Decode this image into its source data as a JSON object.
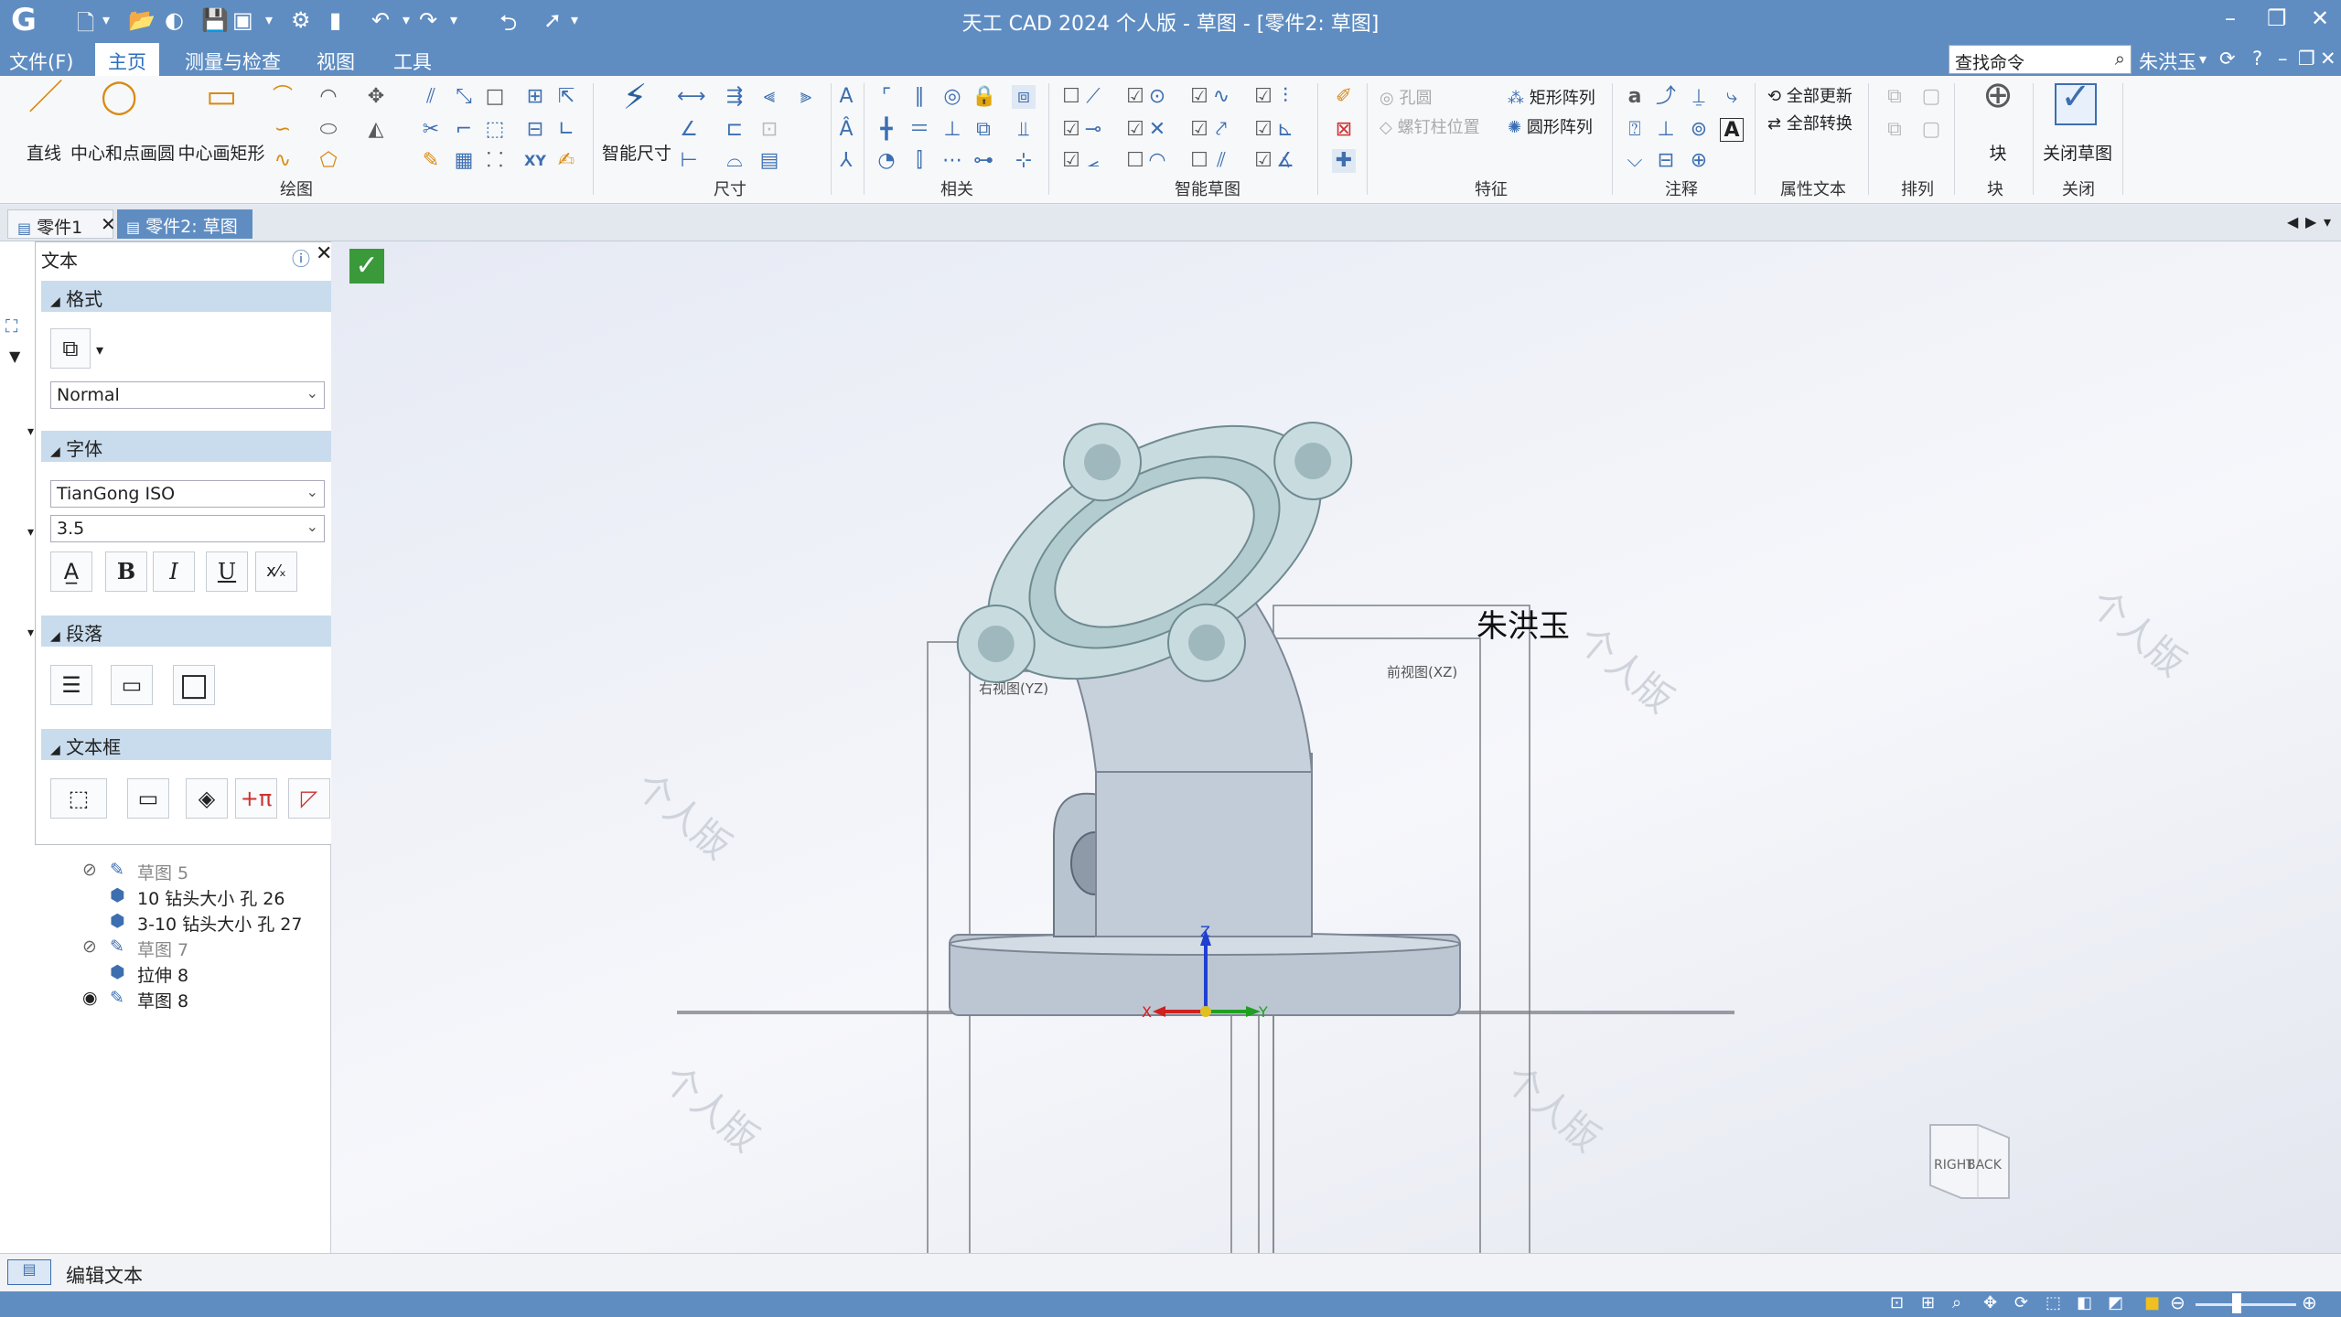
{
  "app": {
    "title": "天工 CAD 2024 个人版 - 草图 - [零件2: 草图]"
  },
  "menu": {
    "file": "文件(F)",
    "home": "主页",
    "measure": "测量与检查",
    "view": "视图",
    "tools": "工具",
    "search_placeholder": "查找命令",
    "user": "朱洪玉"
  },
  "ribbon": {
    "draw": {
      "group": "绘图",
      "line": "直线",
      "circle": "中心和点画圆",
      "rect": "中心画矩形"
    },
    "dimension": {
      "group": "尺寸",
      "smart": "智能尺寸"
    },
    "relations": {
      "group": "相关"
    },
    "smart_sketch": {
      "group": "智能草图"
    },
    "features": {
      "group": "特征",
      "hole": "孔圆",
      "bolt": "螺钉柱位置",
      "rect_array": "矩形阵列",
      "circ_array": "圆形阵列"
    },
    "annotation": {
      "group": "注释"
    },
    "property_text": {
      "group": "属性文本",
      "update_all": "全部更新",
      "convert_all": "全部转换"
    },
    "arrange": {
      "group": "排列"
    },
    "block": {
      "group": "块",
      "block": "块"
    },
    "close": {
      "group": "关闭",
      "close_sketch": "关闭草图"
    }
  },
  "tabs": {
    "part1": "零件1",
    "part2": "零件2: 草图"
  },
  "panel": {
    "title": "文本",
    "format": {
      "label": "格式",
      "style": "Normal"
    },
    "font": {
      "label": "字体",
      "family": "TianGong ISO",
      "size": "3.5"
    },
    "paragraph": {
      "label": "段落"
    },
    "textbox": {
      "label": "文本框"
    }
  },
  "tree": {
    "items": [
      {
        "label": "草图 5",
        "dim": true
      },
      {
        "label": "10 钻头大小 孔 26",
        "dim": false
      },
      {
        "label": "3-10 钻头大小 孔 27",
        "dim": false
      },
      {
        "label": "草图 7",
        "dim": true
      },
      {
        "label": "拉伸 8",
        "dim": false
      },
      {
        "label": "草图 8",
        "dim": false
      }
    ]
  },
  "viewport": {
    "text_annotation": "朱洪玉",
    "view_label_left": "右视图(YZ)",
    "view_label_right": "前视图(XZ)",
    "axis_x": "X",
    "axis_y": "Y",
    "axis_z": "Z",
    "viewcube_right": "RIGHT",
    "viewcube_back": "BACK",
    "watermark": "个人版"
  },
  "status": {
    "text": "编辑文本"
  },
  "colors": {
    "titlebar": "#5f8dc2",
    "accent": "#2a6fc0",
    "section": "#c9dcee",
    "confirm": "#3a9a3a",
    "part": "#b9cad6"
  }
}
